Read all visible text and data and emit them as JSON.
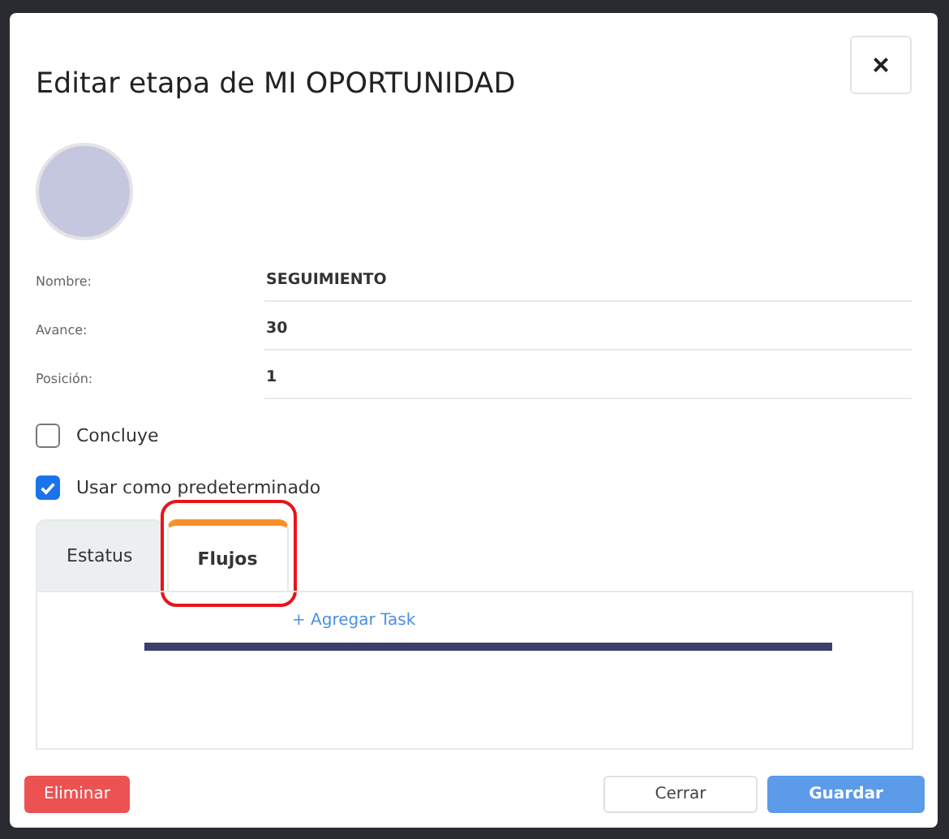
{
  "dialog": {
    "title": "Editar etapa de MI OPORTUNIDAD",
    "close": "×"
  },
  "fields": [
    {
      "label": "Nombre:",
      "value": "SEGUIMIENTO"
    },
    {
      "label": "Avance:",
      "value": "30"
    },
    {
      "label": "Posición:",
      "value": "1"
    }
  ],
  "checkboxes": [
    {
      "label": "Concluye",
      "checked": false
    },
    {
      "label": "Usar como predeterminado",
      "checked": true
    }
  ],
  "tabs": [
    {
      "label": "Estatus",
      "selected": false,
      "highlighted": false
    },
    {
      "label": "Flujos",
      "selected": true,
      "highlighted": true
    }
  ],
  "panel": {
    "link": "+ Agregar Task"
  },
  "footer": {
    "delete": "Eliminar",
    "close": "Cerrar",
    "save": "Guardar"
  }
}
